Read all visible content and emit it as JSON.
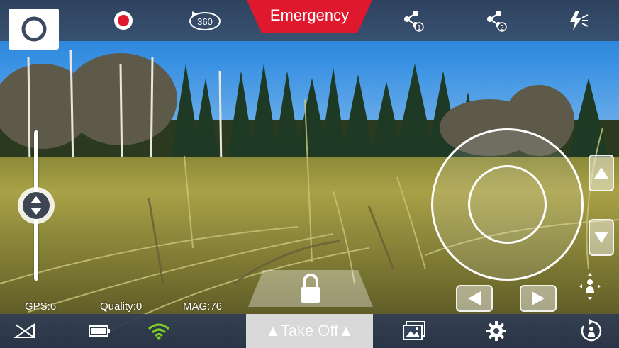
{
  "top_bar": {
    "emergency_label": "Emergency",
    "rotate_360_label": "360",
    "share_1_label": "1",
    "share_2_label": "2"
  },
  "telemetry": {
    "gps": "GPS:6",
    "quality": "Quality:0",
    "mag": "MAG:76"
  },
  "bottom_bar": {
    "takeoff_label": "▲Take Off▲"
  },
  "colors": {
    "bar": "#34445c",
    "emergency": "#e0182d",
    "wifi": "#7ed321",
    "record": "#e0182d"
  },
  "icons": {
    "top": [
      "camera-icon",
      "record-icon",
      "rotate-360-icon",
      "share-1-icon",
      "share-2-icon",
      "flash-mode-icon"
    ],
    "bottom": [
      "signal-off-icon",
      "battery-icon",
      "wifi-icon",
      "gallery-icon",
      "settings-icon",
      "return-home-icon"
    ]
  }
}
